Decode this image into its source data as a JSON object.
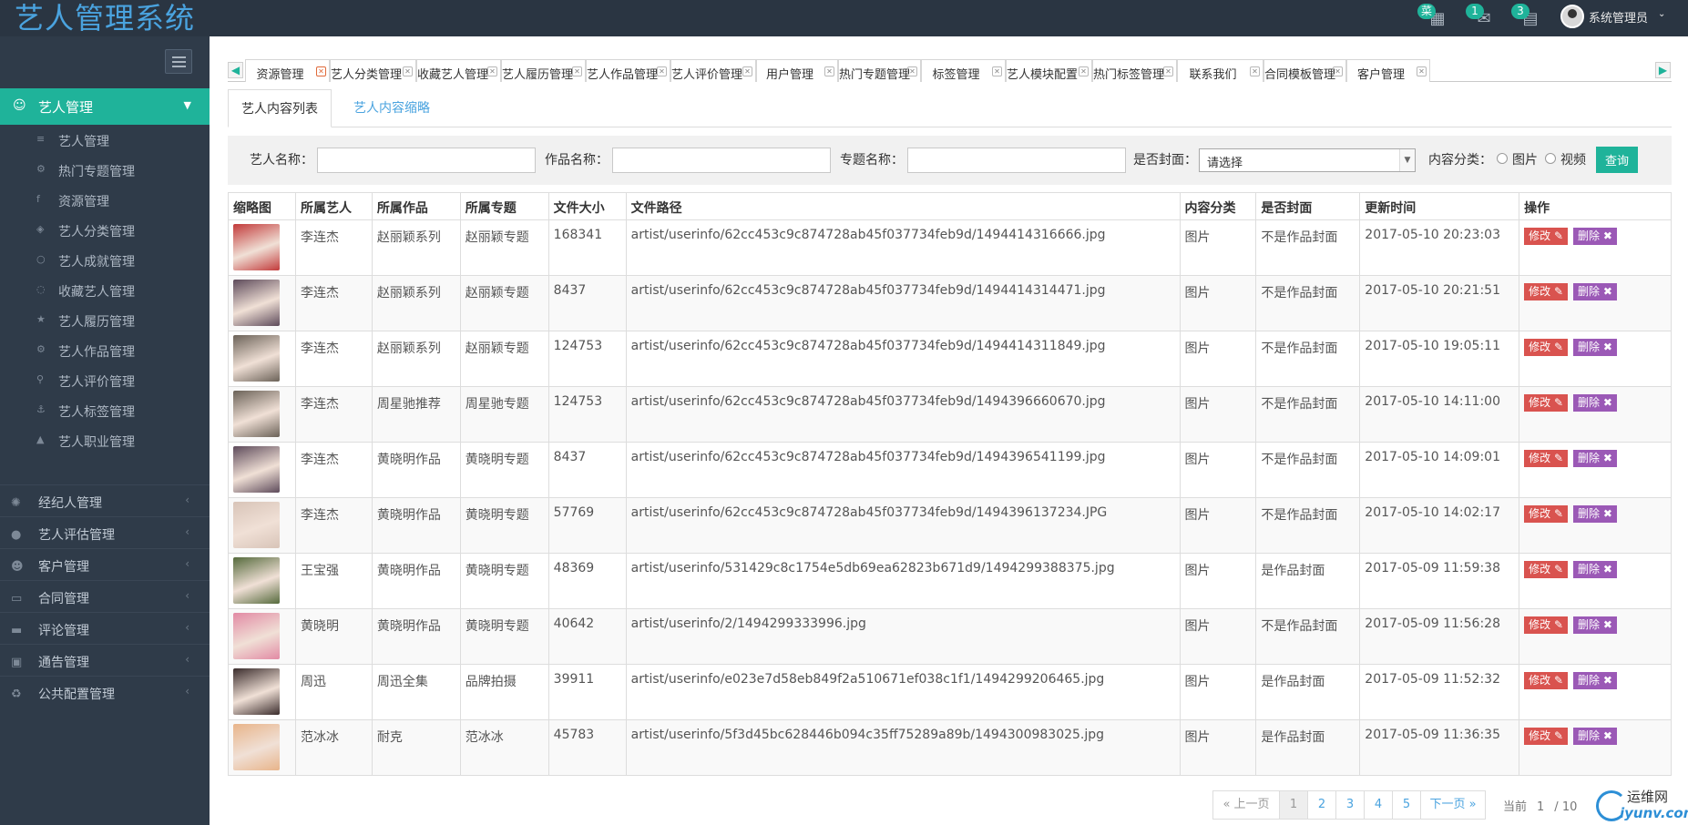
{
  "app": {
    "title": "艺人管理系统"
  },
  "header": {
    "badges": [
      {
        "count": "菜",
        "icon": "grid-icon"
      },
      {
        "count": "1",
        "icon": "mail-icon"
      },
      {
        "count": "3",
        "icon": "calendar-icon"
      }
    ],
    "user_name": "系统管理员"
  },
  "sidebar": {
    "active_group": {
      "label": "艺人管理",
      "icon": "smile-icon"
    },
    "sub_items": [
      {
        "label": "艺人管理",
        "icon": "database-icon"
      },
      {
        "label": "热门专题管理",
        "icon": "gear-icon"
      },
      {
        "label": "资源管理",
        "icon": "facebook-icon"
      },
      {
        "label": "艺人分类管理",
        "icon": "cube-icon"
      },
      {
        "label": "艺人成就管理",
        "icon": "circle-icon"
      },
      {
        "label": "收藏艺人管理",
        "icon": "circle-notch-icon"
      },
      {
        "label": "艺人履历管理",
        "icon": "star-icon"
      },
      {
        "label": "艺人作品管理",
        "icon": "gear-icon"
      },
      {
        "label": "艺人评价管理",
        "icon": "bicycle-icon"
      },
      {
        "label": "艺人标签管理",
        "icon": "anchor-icon"
      },
      {
        "label": "艺人职业管理",
        "icon": "graduation-cap-icon"
      }
    ],
    "groups": [
      {
        "label": "经纪人管理",
        "icon": "sun-icon"
      },
      {
        "label": "艺人评估管理",
        "icon": "bomb-icon"
      },
      {
        "label": "客户管理",
        "icon": "reddit-icon"
      },
      {
        "label": "合同管理",
        "icon": "desktop-icon"
      },
      {
        "label": "评论管理",
        "icon": "car-icon"
      },
      {
        "label": "通告管理",
        "icon": "suitcase-icon"
      },
      {
        "label": "公共配置管理",
        "icon": "recycle-icon"
      }
    ]
  },
  "tabs": [
    {
      "label": "资源管理",
      "active": true
    },
    {
      "label": "艺人分类管理"
    },
    {
      "label": "收藏艺人管理"
    },
    {
      "label": "艺人履历管理"
    },
    {
      "label": "艺人作品管理"
    },
    {
      "label": "艺人评价管理"
    },
    {
      "label": "用户管理"
    },
    {
      "label": "热门专题管理"
    },
    {
      "label": "标签管理"
    },
    {
      "label": "艺人模块配置"
    },
    {
      "label": "热门标签管理"
    },
    {
      "label": "联系我们"
    },
    {
      "label": "合同模板管理"
    },
    {
      "label": "客户管理"
    }
  ],
  "subtabs": [
    {
      "label": "艺人内容列表",
      "active": true
    },
    {
      "label": "艺人内容缩略"
    }
  ],
  "search": {
    "artist_label": "艺人名称：",
    "work_label": "作品名称：",
    "topic_label": "专题名称：",
    "cover_label": "是否封面：",
    "cover_value": "请选择",
    "type_label": "内容分类：",
    "type_image": "图片",
    "type_video": "视频",
    "query_label": "查询"
  },
  "table": {
    "headers": [
      "缩略图",
      "所属艺人",
      "所属作品",
      "所属专题",
      "文件大小",
      "文件路径",
      "内容分类",
      "是否封面",
      "更新时间",
      "操作"
    ],
    "edit_label": "修改",
    "delete_label": "删除",
    "rows": [
      {
        "thumb_color": "#c23a3a",
        "artist": "李连杰",
        "work": "赵丽颖系列",
        "topic": "赵丽颖专题",
        "size": "168341",
        "path": "artist/userinfo/62cc453c9c874728ab45f037734feb9d/1494414316666.jpg",
        "type": "图片",
        "cover": "不是作品封面",
        "time": "2017-05-10 20:23:03"
      },
      {
        "thumb_color": "#5d4a5a",
        "artist": "李连杰",
        "work": "赵丽颖系列",
        "topic": "赵丽颖专题",
        "size": "8437",
        "path": "artist/userinfo/62cc453c9c874728ab45f037734feb9d/1494414314471.jpg",
        "type": "图片",
        "cover": "不是作品封面",
        "time": "2017-05-10 20:21:51"
      },
      {
        "thumb_color": "#6b6258",
        "artist": "李连杰",
        "work": "赵丽颖系列",
        "topic": "赵丽颖专题",
        "size": "124753",
        "path": "artist/userinfo/62cc453c9c874728ab45f037734feb9d/1494414311849.jpg",
        "type": "图片",
        "cover": "不是作品封面",
        "time": "2017-05-10 19:05:11"
      },
      {
        "thumb_color": "#6b6258",
        "artist": "李连杰",
        "work": "周星驰推荐",
        "topic": "周星驰专题",
        "size": "124753",
        "path": "artist/userinfo/62cc453c9c874728ab45f037734feb9d/1494396660670.jpg",
        "type": "图片",
        "cover": "不是作品封面",
        "time": "2017-05-10 14:11:00"
      },
      {
        "thumb_color": "#5d4a5a",
        "artist": "李连杰",
        "work": "黄晓明作品",
        "topic": "黄晓明专题",
        "size": "8437",
        "path": "artist/userinfo/62cc453c9c874728ab45f037734feb9d/1494396541199.jpg",
        "type": "图片",
        "cover": "不是作品封面",
        "time": "2017-05-10 14:09:01"
      },
      {
        "thumb_color": "#d8c4b8",
        "artist": "李连杰",
        "work": "黄晓明作品",
        "topic": "黄晓明专题",
        "size": "57769",
        "path": "artist/userinfo/62cc453c9c874728ab45f037734feb9d/1494396137234.JPG",
        "type": "图片",
        "cover": "不是作品封面",
        "time": "2017-05-10 14:02:17"
      },
      {
        "thumb_color": "#556a3c",
        "artist": "王宝强",
        "work": "黄晓明作品",
        "topic": "黄晓明专题",
        "size": "48369",
        "path": "artist/userinfo/531429c8c1754e5db69ea62823b671d9/1494299388375.jpg",
        "type": "图片",
        "cover": "是作品封面",
        "time": "2017-05-09 11:59:38"
      },
      {
        "thumb_color": "#e28aa4",
        "artist": "黄晓明",
        "work": "黄晓明作品",
        "topic": "黄晓明专题",
        "size": "40642",
        "path": "artist/userinfo/2/1494299333996.jpg",
        "type": "图片",
        "cover": "不是作品封面",
        "time": "2017-05-09 11:56:28"
      },
      {
        "thumb_color": "#3a2c2c",
        "artist": "周迅",
        "work": "周迅全集",
        "topic": "品牌拍摄",
        "size": "39911",
        "path": "artist/userinfo/e023e7d58eb849f2a510671ef038c1f1/1494299206465.jpg",
        "type": "图片",
        "cover": "是作品封面",
        "time": "2017-05-09 11:52:32"
      },
      {
        "thumb_color": "#e8b48a",
        "artist": "范冰冰",
        "work": "耐克",
        "topic": "范冰冰",
        "size": "45783",
        "path": "artist/userinfo/5f3d45bc628446b094c35ff75289a89b/1494300983025.jpg",
        "type": "图片",
        "cover": "是作品封面",
        "time": "2017-05-09 11:36:35"
      }
    ]
  },
  "pagination": {
    "prev_label": "« 上一页",
    "pages": [
      "1",
      "2",
      "3",
      "4",
      "5"
    ],
    "current_page": "1",
    "next_label": "下一页 »",
    "current_label": "当前",
    "current_value": "1",
    "separator": "/",
    "total_pages": "10"
  },
  "watermark": {
    "name": "运维网",
    "url": "iyunv.com"
  }
}
